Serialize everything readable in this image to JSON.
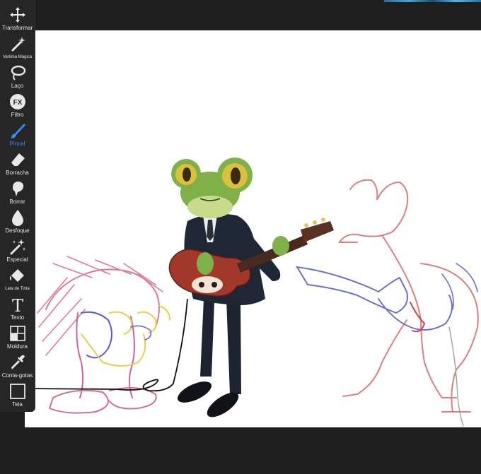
{
  "toolbar": {
    "tools": [
      {
        "label": "Transformar",
        "icon": "move-icon"
      },
      {
        "label": "Varinha Mágica",
        "icon": "magic-wand-icon"
      },
      {
        "label": "Laço",
        "icon": "lasso-icon"
      },
      {
        "label": "Filtro",
        "icon": "fx-icon"
      },
      {
        "label": "Pincel",
        "icon": "brush-icon",
        "active": true
      },
      {
        "label": "Borracha",
        "icon": "eraser-icon"
      },
      {
        "label": "Borrar",
        "icon": "smudge-icon"
      },
      {
        "label": "Desfoque",
        "icon": "blur-drop-icon"
      },
      {
        "label": "Especial",
        "icon": "special-sparkle-icon"
      },
      {
        "label": "Lata de Tinta",
        "icon": "paint-bucket-icon"
      },
      {
        "label": "Texto",
        "icon": "text-icon"
      },
      {
        "label": "Moldura",
        "icon": "frame-icon"
      },
      {
        "label": "Conta-gotas",
        "icon": "eyedropper-icon"
      },
      {
        "label": "Tela",
        "icon": "canvas-icon"
      }
    ]
  },
  "colors": {
    "active": "#3a8df0",
    "toolbar_bg": "#262626",
    "workspace_bg": "#1e1e1e"
  }
}
